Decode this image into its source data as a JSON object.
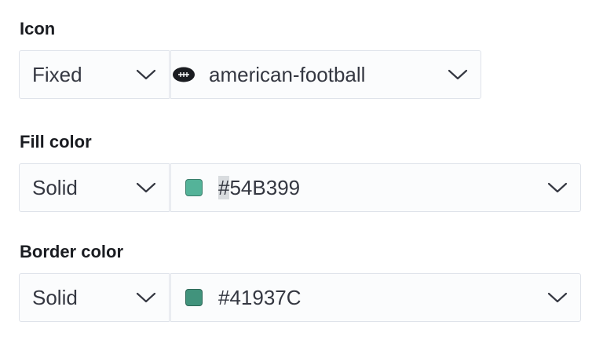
{
  "icon": {
    "label": "Icon",
    "mode": "Fixed",
    "value": "american-football",
    "icon_name": "american-football-icon"
  },
  "fill_color": {
    "label": "Fill color",
    "mode": "Solid",
    "hash": "#",
    "value": "54B399",
    "color": "#54B399"
  },
  "border_color": {
    "label": "Border color",
    "mode": "Solid",
    "value": "#41937C",
    "color": "#41937C"
  }
}
